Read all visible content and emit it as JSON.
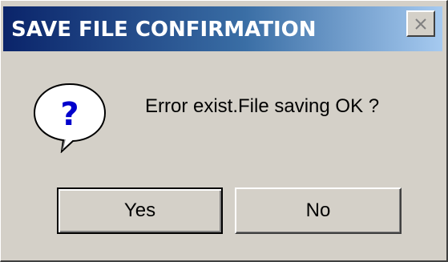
{
  "window": {
    "title": "SAVE FILE CONFIRMATION",
    "close_icon": "close-icon"
  },
  "body": {
    "icon": "question-icon",
    "icon_glyph": "?",
    "message": "Error exist.File saving OK ?"
  },
  "buttons": {
    "yes_label": "Yes",
    "no_label": "No",
    "default": "yes"
  },
  "colors": {
    "titlebar_start": "#0a246a",
    "titlebar_end": "#a6caf0",
    "dialog_bg": "#d4d0c8",
    "icon_question": "#0000cc"
  }
}
